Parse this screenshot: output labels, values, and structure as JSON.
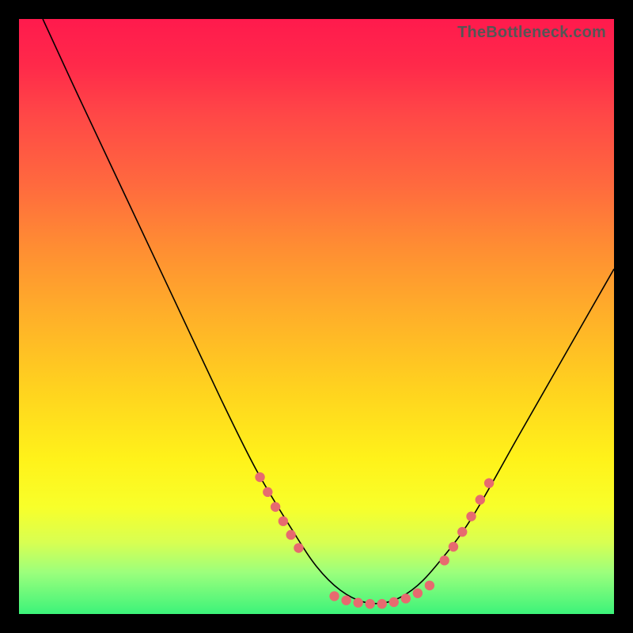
{
  "watermark": "TheBottleneck.com",
  "chart_data": {
    "type": "line",
    "title": "",
    "xlabel": "",
    "ylabel": "",
    "xlim": [
      0,
      100
    ],
    "ylim": [
      0,
      100
    ],
    "series": [
      {
        "name": "curve",
        "x": [
          4,
          10,
          18,
          26,
          34,
          40,
          46,
          50,
          54,
          58,
          62,
          66,
          70,
          76,
          84,
          92,
          100
        ],
        "y": [
          100,
          87,
          70,
          53,
          36,
          24,
          14,
          8,
          4,
          2,
          2,
          4,
          8,
          16,
          30,
          44,
          58
        ]
      }
    ],
    "marker_groups": [
      {
        "name": "left-cluster",
        "x": [
          40.5,
          41.8,
          43.1,
          44.4,
          45.7,
          47.0
        ],
        "y": [
          23.0,
          20.5,
          18.0,
          15.6,
          13.3,
          11.1
        ]
      },
      {
        "name": "bottom-cluster",
        "x": [
          53,
          55,
          57,
          59,
          61,
          63,
          65,
          67,
          69
        ],
        "y": [
          3.0,
          2.3,
          1.9,
          1.7,
          1.7,
          2.0,
          2.6,
          3.5,
          4.8
        ]
      },
      {
        "name": "right-cluster",
        "x": [
          71.5,
          73.0,
          74.5,
          76.0,
          77.5,
          79.0
        ],
        "y": [
          9.0,
          11.3,
          13.8,
          16.4,
          19.2,
          22.0
        ]
      }
    ],
    "colors": {
      "curve": "#000000",
      "markers": "#e76a6f",
      "gradient_top": "#ff1a4d",
      "gradient_bottom": "#3cf37a"
    }
  }
}
